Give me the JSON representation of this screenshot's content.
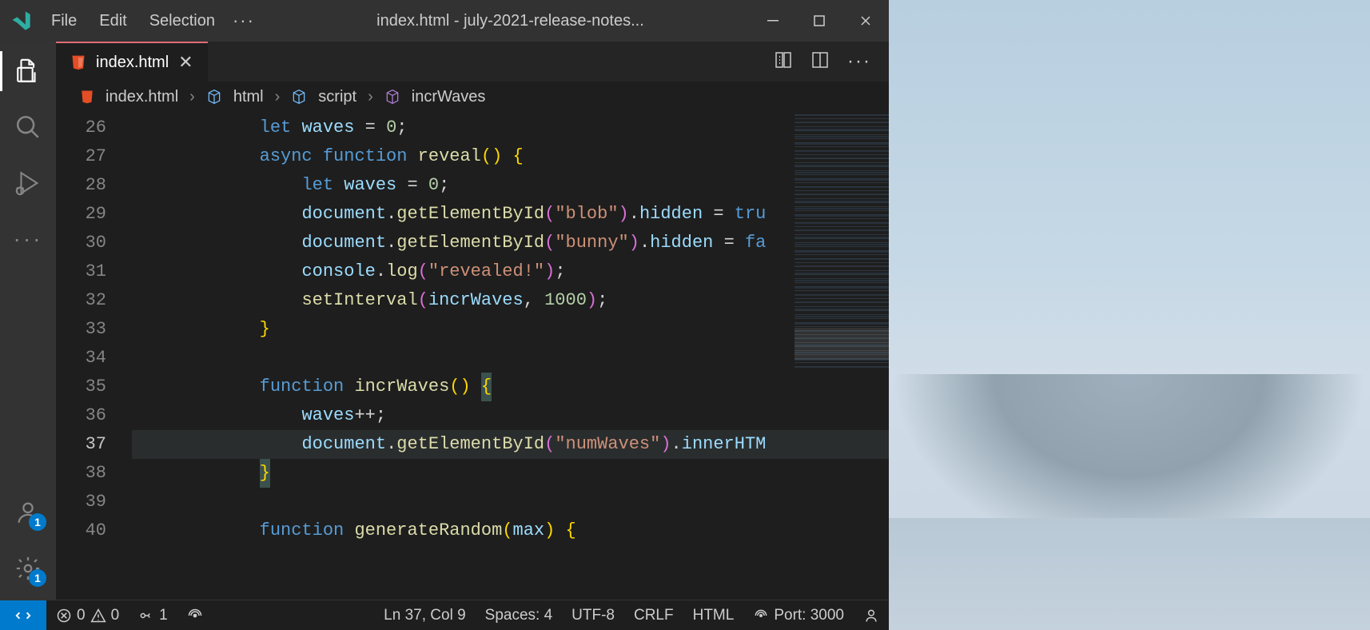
{
  "titleBar": {
    "menus": [
      "File",
      "Edit",
      "Selection"
    ],
    "more": "···",
    "windowTitle": "index.html - july-2021-release-notes..."
  },
  "activityBar": {
    "accountsBadge": "1",
    "settingsBadge": "1"
  },
  "tabs": {
    "active": {
      "label": "index.html"
    }
  },
  "breadcrumbs": {
    "file": "index.html",
    "html": "html",
    "script": "script",
    "func": "incrWaves"
  },
  "code": {
    "startLine": 26,
    "breakpointLine": 37,
    "highlightLine": 37,
    "lines": [
      {
        "n": 26,
        "tokens": [
          [
            "",
            "        "
          ],
          [
            "t-blue",
            "let"
          ],
          [
            "",
            " "
          ],
          [
            "t-lightblue",
            "waves"
          ],
          [
            "",
            " "
          ],
          [
            "t-white",
            "="
          ],
          [
            "",
            " "
          ],
          [
            "t-green",
            "0"
          ],
          [
            "t-white",
            ";"
          ]
        ]
      },
      {
        "n": 27,
        "tokens": [
          [
            "",
            "        "
          ],
          [
            "t-blue",
            "async"
          ],
          [
            "",
            " "
          ],
          [
            "t-blue",
            "function"
          ],
          [
            "",
            " "
          ],
          [
            "t-yellow",
            "reveal"
          ],
          [
            "t-brace",
            "()"
          ],
          [
            "",
            " "
          ],
          [
            "t-brace",
            "{"
          ]
        ]
      },
      {
        "n": 28,
        "tokens": [
          [
            "",
            "            "
          ],
          [
            "t-blue",
            "let"
          ],
          [
            "",
            " "
          ],
          [
            "t-lightblue",
            "waves"
          ],
          [
            "",
            " "
          ],
          [
            "t-white",
            "="
          ],
          [
            "",
            " "
          ],
          [
            "t-green",
            "0"
          ],
          [
            "t-white",
            ";"
          ]
        ]
      },
      {
        "n": 29,
        "tokens": [
          [
            "",
            "            "
          ],
          [
            "t-lightblue",
            "document"
          ],
          [
            "t-white",
            "."
          ],
          [
            "t-yellow",
            "getElementById"
          ],
          [
            "t-brace2",
            "("
          ],
          [
            "t-string",
            "\"blob\""
          ],
          [
            "t-brace2",
            ")"
          ],
          [
            "t-white",
            "."
          ],
          [
            "t-lightblue",
            "hidden"
          ],
          [
            "",
            " "
          ],
          [
            "t-white",
            "="
          ],
          [
            "",
            " "
          ],
          [
            "t-blue",
            "tru"
          ]
        ]
      },
      {
        "n": 30,
        "tokens": [
          [
            "",
            "            "
          ],
          [
            "t-lightblue",
            "document"
          ],
          [
            "t-white",
            "."
          ],
          [
            "t-yellow",
            "getElementById"
          ],
          [
            "t-brace2",
            "("
          ],
          [
            "t-string",
            "\"bunny\""
          ],
          [
            "t-brace2",
            ")"
          ],
          [
            "t-white",
            "."
          ],
          [
            "t-lightblue",
            "hidden"
          ],
          [
            "",
            " "
          ],
          [
            "t-white",
            "="
          ],
          [
            "",
            " "
          ],
          [
            "t-blue",
            "fa"
          ]
        ]
      },
      {
        "n": 31,
        "tokens": [
          [
            "",
            "            "
          ],
          [
            "t-lightblue",
            "console"
          ],
          [
            "t-white",
            "."
          ],
          [
            "t-yellow",
            "log"
          ],
          [
            "t-brace2",
            "("
          ],
          [
            "t-string",
            "\"revealed!\""
          ],
          [
            "t-brace2",
            ")"
          ],
          [
            "t-white",
            ";"
          ]
        ]
      },
      {
        "n": 32,
        "tokens": [
          [
            "",
            "            "
          ],
          [
            "t-yellow",
            "setInterval"
          ],
          [
            "t-brace2",
            "("
          ],
          [
            "t-lightblue",
            "incrWaves"
          ],
          [
            "t-white",
            ", "
          ],
          [
            "t-green",
            "1000"
          ],
          [
            "t-brace2",
            ")"
          ],
          [
            "t-white",
            ";"
          ]
        ]
      },
      {
        "n": 33,
        "tokens": [
          [
            "",
            "        "
          ],
          [
            "t-brace",
            "}"
          ]
        ]
      },
      {
        "n": 34,
        "tokens": [
          [
            "",
            ""
          ]
        ]
      },
      {
        "n": 35,
        "tokens": [
          [
            "",
            "        "
          ],
          [
            "t-blue",
            "function"
          ],
          [
            "",
            " "
          ],
          [
            "t-yellow",
            "incrWaves"
          ],
          [
            "t-brace",
            "()"
          ],
          [
            "",
            " "
          ],
          [
            "br-match t-brace",
            "{"
          ]
        ]
      },
      {
        "n": 36,
        "tokens": [
          [
            "",
            "            "
          ],
          [
            "t-lightblue",
            "waves"
          ],
          [
            "t-white",
            "++;"
          ]
        ]
      },
      {
        "n": 37,
        "tokens": [
          [
            "",
            "            "
          ],
          [
            "t-lightblue",
            "document"
          ],
          [
            "t-white",
            "."
          ],
          [
            "t-yellow",
            "getElementById"
          ],
          [
            "t-brace2",
            "("
          ],
          [
            "t-string",
            "\"numWaves\""
          ],
          [
            "t-brace2",
            ")"
          ],
          [
            "t-white",
            "."
          ],
          [
            "t-lightblue",
            "innerHTM"
          ]
        ]
      },
      {
        "n": 38,
        "tokens": [
          [
            "",
            "        "
          ],
          [
            "br-match t-brace",
            "}"
          ]
        ]
      },
      {
        "n": 39,
        "tokens": [
          [
            "",
            ""
          ]
        ]
      },
      {
        "n": 40,
        "tokens": [
          [
            "",
            "        "
          ],
          [
            "t-blue",
            "function"
          ],
          [
            "",
            " "
          ],
          [
            "t-yellow",
            "generateRandom"
          ],
          [
            "t-brace",
            "("
          ],
          [
            "t-lightblue",
            "max"
          ],
          [
            "t-brace",
            ")"
          ],
          [
            "",
            " "
          ],
          [
            "t-brace",
            "{"
          ]
        ]
      }
    ]
  },
  "statusBar": {
    "errors": "0",
    "warnings": "0",
    "ports": "1",
    "lnCol": "Ln 37, Col 9",
    "spaces": "Spaces: 4",
    "encoding": "UTF-8",
    "eol": "CRLF",
    "lang": "HTML",
    "port": "Port: 3000"
  }
}
